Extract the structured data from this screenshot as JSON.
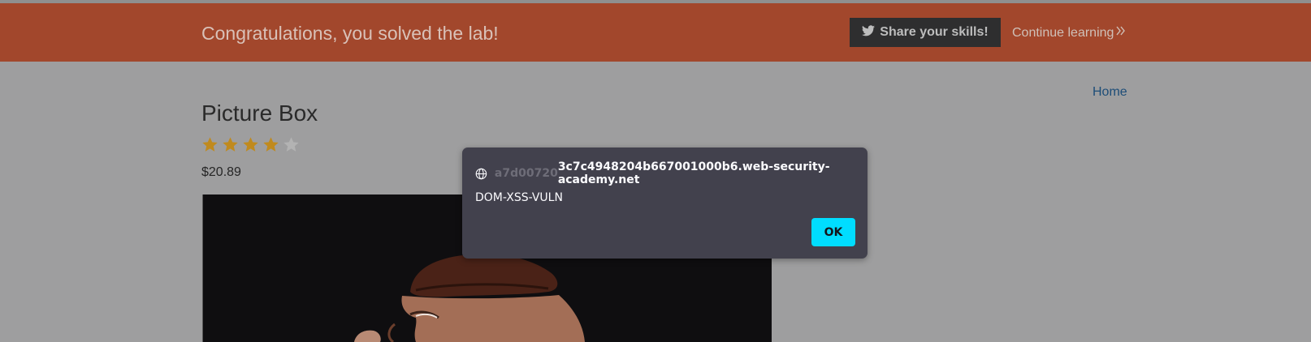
{
  "banner": {
    "message": "Congratulations, you solved the lab!",
    "share_label": "Share your skills!",
    "share_icon": "twitter-icon",
    "continue_label": "Continue learning",
    "continue_icon": "double-chevron-right-icon",
    "background_color": "#a2472c"
  },
  "nav": {
    "home_label": "Home"
  },
  "product": {
    "title": "Picture Box",
    "rating": 4,
    "rating_max": 5,
    "price": "$20.89",
    "star_color": "#c08a1e"
  },
  "alert_dialog": {
    "origin_prefix": "a7d00720",
    "origin_main": "3c7c4948204b667001000b6.web-security-academy.net",
    "origin_icon": "globe-icon",
    "message": "DOM-XSS-VULN",
    "ok_label": "OK",
    "accent_color": "#00ddff"
  }
}
